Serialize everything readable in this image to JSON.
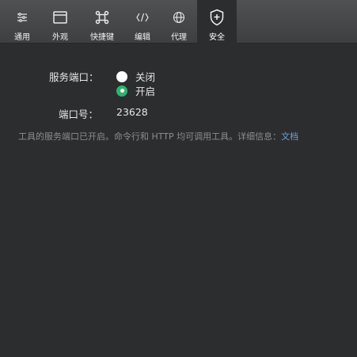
{
  "tabs": [
    {
      "label": "通用",
      "icon": "sliders-icon"
    },
    {
      "label": "外观",
      "icon": "window-icon"
    },
    {
      "label": "快捷键",
      "icon": "command-key-icon"
    },
    {
      "label": "编辑",
      "icon": "code-brackets-icon"
    },
    {
      "label": "代理",
      "icon": "globe-icon"
    },
    {
      "label": "安全",
      "icon": "shield-plus-icon",
      "active": true
    }
  ],
  "settings": {
    "service_port_label": "服务端口：",
    "options": [
      {
        "label": "关闭",
        "selected": false
      },
      {
        "label": "开启",
        "selected": true
      }
    ],
    "port_number_label": "端口号：",
    "port_number_value": "23628",
    "note_text": "工具的服务端口已开启。命令行和 HTTP 均可调用工具。详细信息：",
    "note_link": "文档"
  },
  "colors": {
    "background": "#2c2d2e",
    "accent": "#2fb36d",
    "link": "#6f9fd8"
  }
}
